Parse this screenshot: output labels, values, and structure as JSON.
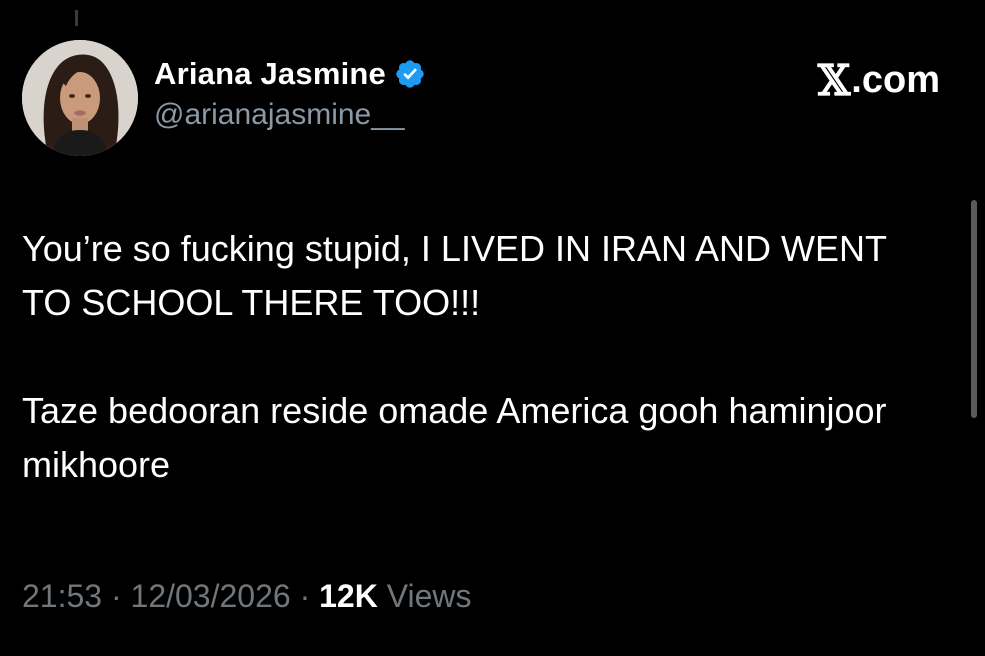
{
  "author": {
    "display_name": "Ariana Jasmine",
    "handle": "@arianajasmine__",
    "verified_icon": "verified-badge-icon",
    "verified_color": "#1d9bf0"
  },
  "brand": {
    "x_glyph": "𝕏",
    "suffix": ".com"
  },
  "tweet": {
    "line1": "You’re so fucking stupid, I LIVED IN IRAN AND WENT TO SCHOOL THERE TOO!!!",
    "line2": "Taze bedooran reside omade America gooh haminjoor mikhoore"
  },
  "meta": {
    "time": "21:53",
    "separator": "·",
    "date": "12/03/2026",
    "views_count": "12K",
    "views_label": "Views"
  },
  "colors": {
    "background": "#000000",
    "text_primary": "#ffffff",
    "text_secondary": "#71767b"
  }
}
